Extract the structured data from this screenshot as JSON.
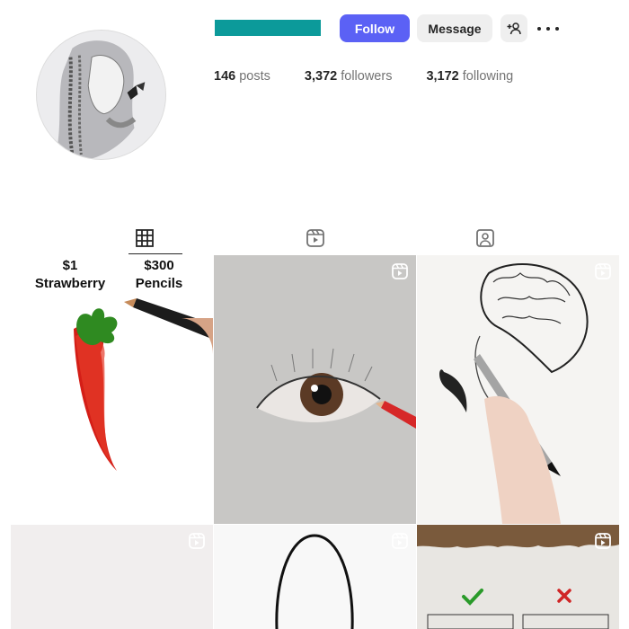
{
  "profile": {
    "follow_label": "Follow",
    "message_label": "Message",
    "stats": {
      "posts_count": "146",
      "posts_label": "posts",
      "followers_count": "3,372",
      "followers_label": "followers",
      "following_count": "3,172",
      "following_label": "following"
    }
  },
  "colors": {
    "username_redaction": "#0c9a9a",
    "follow_button": "#5b61f5"
  },
  "tabs": [
    {
      "icon": "grid-icon",
      "active": true
    },
    {
      "icon": "reels-icon",
      "active": false
    },
    {
      "icon": "tagged-icon",
      "active": false
    }
  ],
  "posts": [
    {
      "caption_left_price": "$1",
      "caption_left_item": "Strawberry",
      "caption_right_price": "$300",
      "caption_right_item": "Pencils",
      "type": "reel"
    },
    {
      "type": "reel"
    },
    {
      "type": "reel"
    },
    {
      "type": "reel"
    },
    {
      "type": "reel"
    },
    {
      "type": "reel"
    }
  ]
}
